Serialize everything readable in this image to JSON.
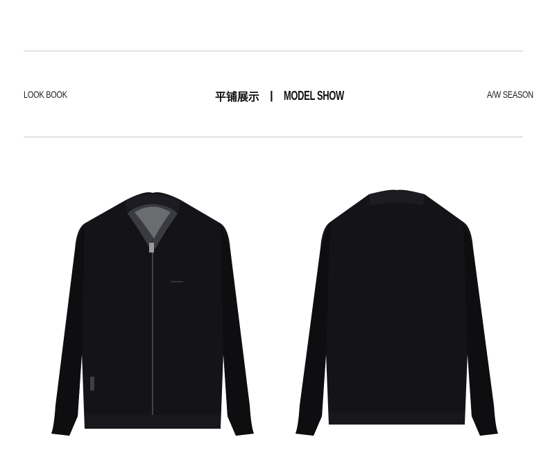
{
  "header": {
    "left_label": "LOOK BOOK",
    "center_cn": "平铺展示",
    "separator": "|",
    "center_en": "MODEL SHOW",
    "right_label": "A/W SEASON"
  },
  "images": {
    "front": "jacket-front",
    "back": "jacket-back"
  },
  "colors": {
    "jacket": "#141418",
    "rule": "#c9c9c9",
    "text": "#1a1a1a"
  }
}
